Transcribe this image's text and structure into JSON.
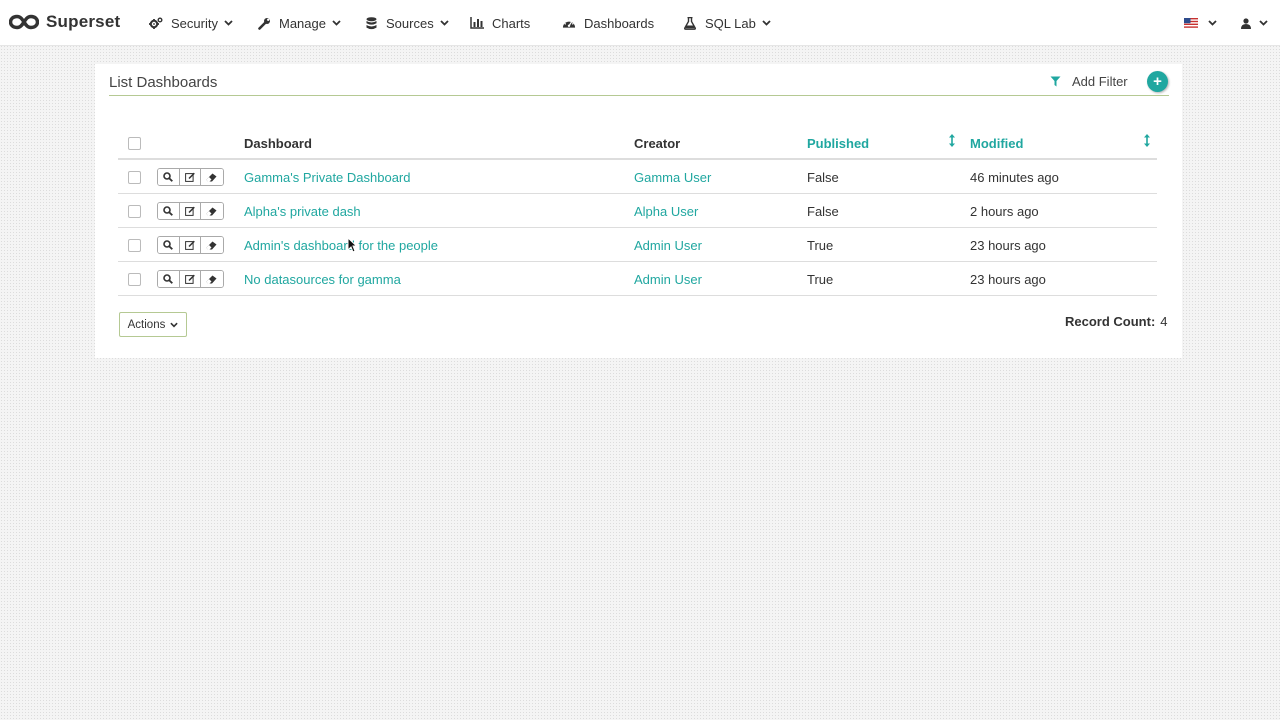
{
  "navbar": {
    "brand": "Superset",
    "items": [
      {
        "label": "Security",
        "icon": "cogs-icon",
        "dropdown": true
      },
      {
        "label": "Manage",
        "icon": "wrench-icon",
        "dropdown": true
      },
      {
        "label": "Sources",
        "icon": "database-icon",
        "dropdown": true
      },
      {
        "label": "Charts",
        "icon": "bar-chart-icon",
        "dropdown": false
      },
      {
        "label": "Dashboards",
        "icon": "dashboard-icon",
        "dropdown": false
      },
      {
        "label": "SQL Lab",
        "icon": "flask-icon",
        "dropdown": true
      }
    ],
    "language_icon": "us-flag-icon",
    "user_icon": "user-icon"
  },
  "panel": {
    "title": "List Dashboards",
    "add_filter_label": "Add Filter",
    "add_button_label": "+"
  },
  "table": {
    "columns": [
      {
        "label": "Dashboard",
        "sortable": false
      },
      {
        "label": "Creator",
        "sortable": false
      },
      {
        "label": "Published",
        "sortable": true
      },
      {
        "label": "Modified",
        "sortable": true
      }
    ],
    "rows": [
      {
        "dashboard": "Gamma's Private Dashboard",
        "creator": "Gamma User",
        "published": "False",
        "modified": "46 minutes ago"
      },
      {
        "dashboard": "Alpha's private dash",
        "creator": "Alpha User",
        "published": "False",
        "modified": "2 hours ago"
      },
      {
        "dashboard": "Admin's dashboard for the people",
        "creator": "Admin User",
        "published": "True",
        "modified": "23 hours ago"
      },
      {
        "dashboard": "No datasources for gamma",
        "creator": "Admin User",
        "published": "True",
        "modified": "23 hours ago"
      }
    ]
  },
  "footer": {
    "actions_label": "Actions",
    "record_count_label": "Record Count:",
    "record_count_value": "4"
  },
  "colors": {
    "accent": "#20a7a0",
    "header_rule": "#b5c993"
  }
}
